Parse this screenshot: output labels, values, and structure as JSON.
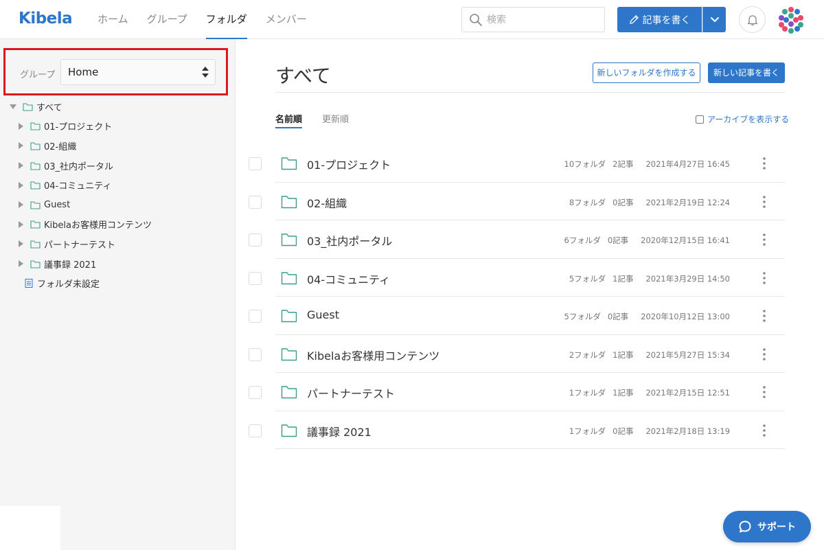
{
  "colors": {
    "accent": "#2d76c9",
    "folder": "#3a9e8f",
    "highlight": "#d9191e"
  },
  "header": {
    "logo": "Kibela",
    "nav": [
      {
        "label": "ホーム",
        "active": false
      },
      {
        "label": "グループ",
        "active": false
      },
      {
        "label": "フォルダ",
        "active": true
      },
      {
        "label": "メンバー",
        "active": false
      }
    ],
    "search": {
      "placeholder": "検索",
      "value": ""
    },
    "write_button": "記事を書く",
    "icons": [
      "search-icon",
      "pencil-icon",
      "chevron-down-icon",
      "bell-icon",
      "avatar"
    ]
  },
  "sidebar": {
    "group_label": "グループ",
    "group_value": "Home",
    "tree": {
      "root": "すべて",
      "children": [
        "01-プロジェクト",
        "02-組織",
        "03_社内ポータル",
        "04-コミュニティ",
        "Guest",
        "Kibelaお客様用コンテンツ",
        "パートナーテスト",
        "議事録 2021"
      ],
      "unset": "フォルダ未設定"
    }
  },
  "main": {
    "title": "すべて",
    "new_folder_button": "新しいフォルダを作成する",
    "new_note_button": "新しい記事を書く",
    "sort_tabs": [
      {
        "label": "名前順",
        "active": true
      },
      {
        "label": "更新順",
        "active": false
      }
    ],
    "show_archive": "アーカイブを表示する",
    "folders": [
      {
        "name": "01-プロジェクト",
        "folders": "10フォルダ",
        "notes": "2記事",
        "updated": "2021年4月27日 16:45"
      },
      {
        "name": "02-組織",
        "folders": "8フォルダ",
        "notes": "0記事",
        "updated": "2021年2月19日 12:24"
      },
      {
        "name": "03_社内ポータル",
        "folders": "6フォルダ",
        "notes": "0記事",
        "updated": "2020年12月15日 16:41"
      },
      {
        "name": "04-コミュニティ",
        "folders": "5フォルダ",
        "notes": "1記事",
        "updated": "2021年3月29日 14:50"
      },
      {
        "name": "Guest",
        "folders": "5フォルダ",
        "notes": "0記事",
        "updated": "2020年10月12日 13:00"
      },
      {
        "name": "Kibelaお客様用コンテンツ",
        "folders": "2フォルダ",
        "notes": "1記事",
        "updated": "2021年5月27日 15:34"
      },
      {
        "name": "パートナーテスト",
        "folders": "1フォルダ",
        "notes": "1記事",
        "updated": "2021年2月15日 12:51"
      },
      {
        "name": "議事録 2021",
        "folders": "1フォルダ",
        "notes": "0記事",
        "updated": "2021年2月18日 13:19"
      }
    ]
  },
  "support_button": "サポート"
}
